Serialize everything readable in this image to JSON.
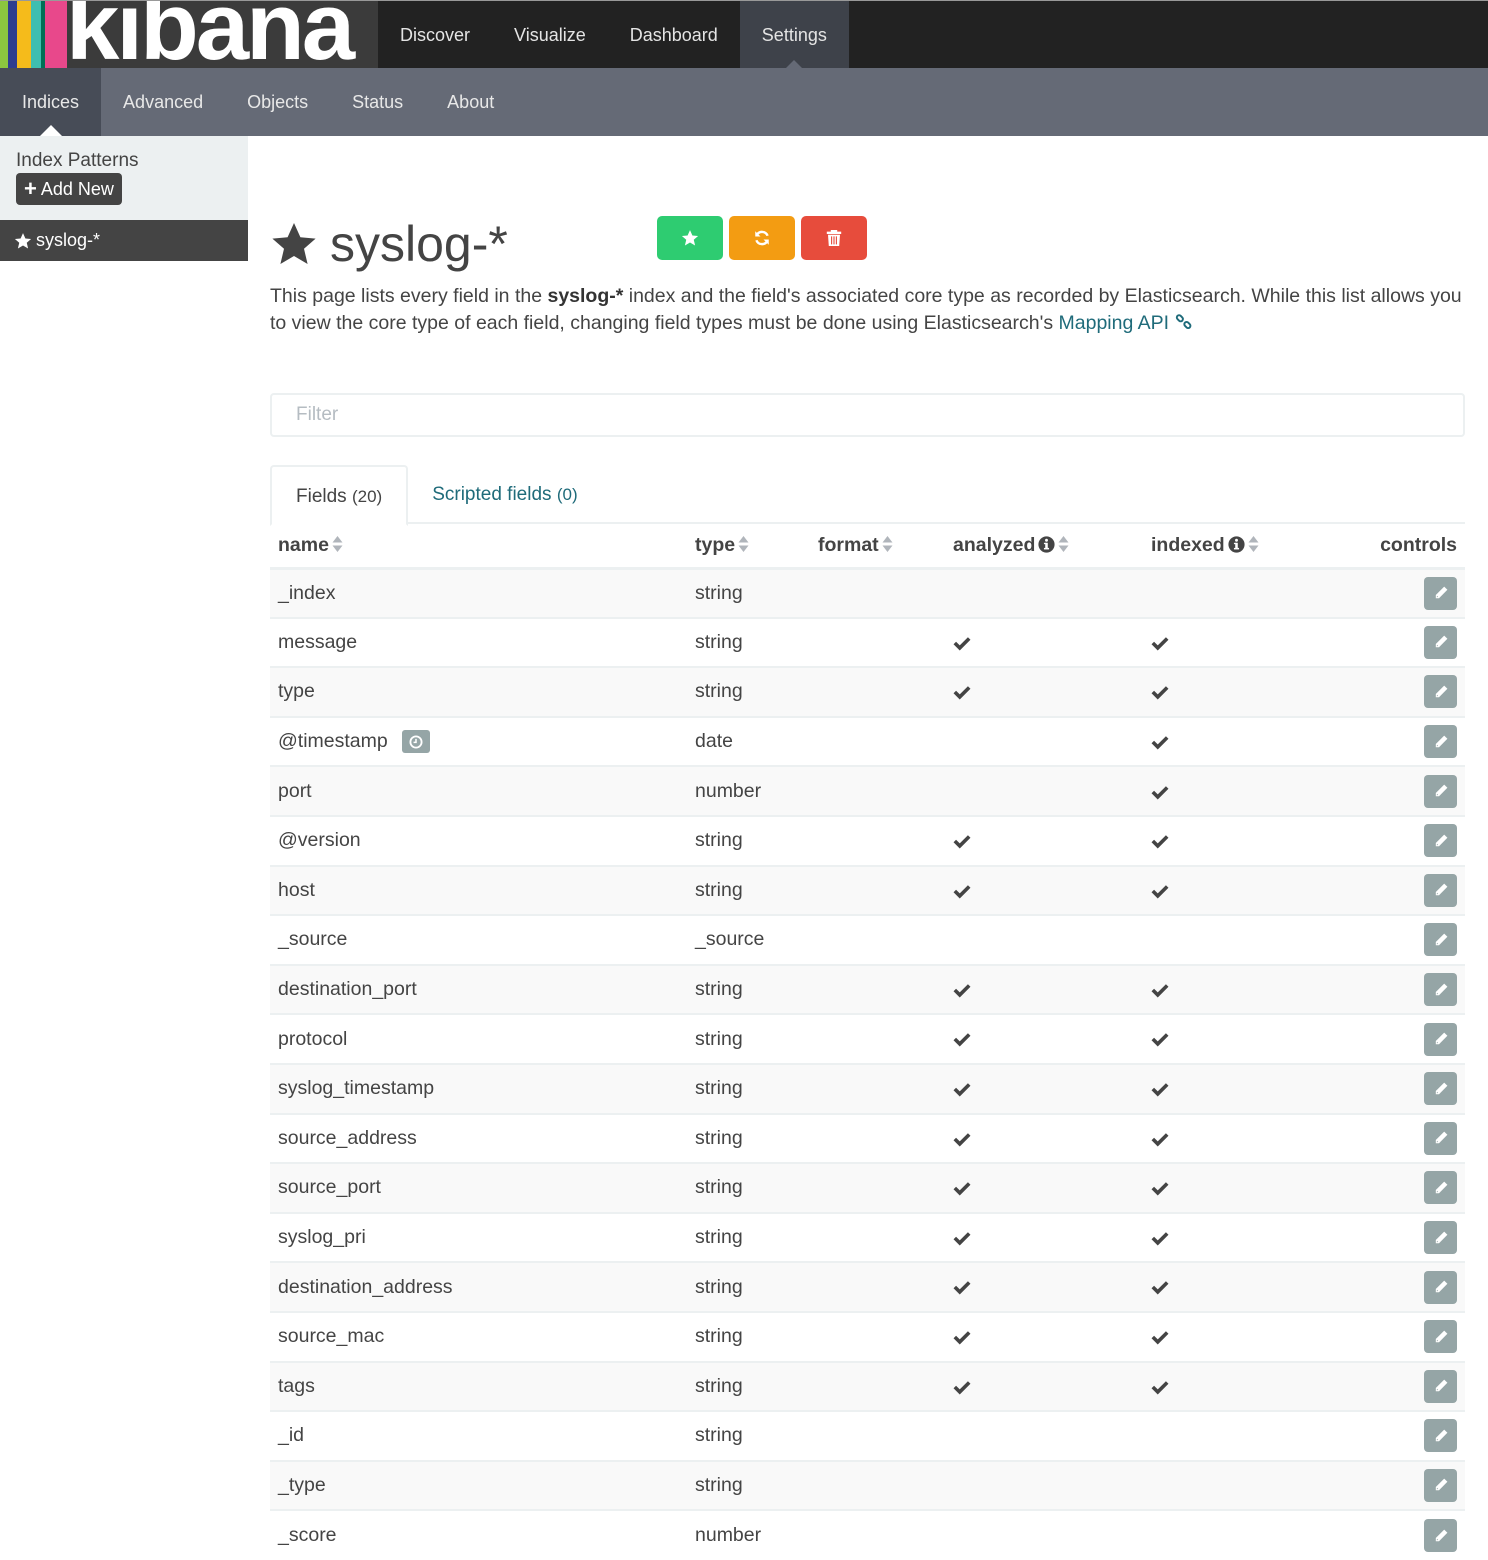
{
  "brand": {
    "name": "kibana",
    "stripe_colors": [
      "#8cc63f",
      "#2e3d8f",
      "#f5bb1b",
      "#3ebeb0",
      "#006f55",
      "#e8488b"
    ]
  },
  "topnav": {
    "items": [
      {
        "label": "Discover",
        "active": false
      },
      {
        "label": "Visualize",
        "active": false
      },
      {
        "label": "Dashboard",
        "active": false
      },
      {
        "label": "Settings",
        "active": true
      }
    ]
  },
  "subnav": {
    "items": [
      {
        "label": "Indices",
        "active": true
      },
      {
        "label": "Advanced",
        "active": false
      },
      {
        "label": "Objects",
        "active": false
      },
      {
        "label": "Status",
        "active": false
      },
      {
        "label": "About",
        "active": false
      }
    ]
  },
  "sidebar": {
    "heading": "Index Patterns",
    "add_new_label": "Add New",
    "patterns": [
      {
        "label": "syslog-*",
        "default": true
      }
    ]
  },
  "index": {
    "title": "syslog-*",
    "actions": [
      {
        "name": "set-default",
        "icon": "star-icon",
        "color": "#2ecc71"
      },
      {
        "name": "refresh-fields",
        "icon": "refresh-icon",
        "color": "#f39c12"
      },
      {
        "name": "delete-index-pattern",
        "icon": "trash-icon",
        "color": "#e74c3c"
      }
    ],
    "description": {
      "part1": "This page lists every field in the ",
      "bold": "syslog-*",
      "part2": " index and the field's associated core type as recorded by Elasticsearch. While this list allows you to view the core type of each field, changing field types must be done using Elasticsearch's ",
      "link_text": "Mapping API"
    }
  },
  "filter": {
    "placeholder": "Filter",
    "value": ""
  },
  "tabs": [
    {
      "label": "Fields",
      "count": "(20)",
      "active": true
    },
    {
      "label": "Scripted fields",
      "count": "(0)",
      "active": false
    }
  ],
  "table": {
    "columns": {
      "name": "name",
      "type": "type",
      "format": "format",
      "analyzed": "analyzed",
      "indexed": "indexed",
      "controls": "controls"
    },
    "rows": [
      {
        "name": "_index",
        "type": "string",
        "format": "",
        "analyzed": false,
        "indexed": false
      },
      {
        "name": "message",
        "type": "string",
        "format": "",
        "analyzed": true,
        "indexed": true
      },
      {
        "name": "type",
        "type": "string",
        "format": "",
        "analyzed": true,
        "indexed": true
      },
      {
        "name": "@timestamp",
        "type": "date",
        "format": "",
        "analyzed": false,
        "indexed": true,
        "time_field": true
      },
      {
        "name": "port",
        "type": "number",
        "format": "",
        "analyzed": false,
        "indexed": true
      },
      {
        "name": "@version",
        "type": "string",
        "format": "",
        "analyzed": true,
        "indexed": true
      },
      {
        "name": "host",
        "type": "string",
        "format": "",
        "analyzed": true,
        "indexed": true
      },
      {
        "name": "_source",
        "type": "_source",
        "format": "",
        "analyzed": false,
        "indexed": false
      },
      {
        "name": "destination_port",
        "type": "string",
        "format": "",
        "analyzed": true,
        "indexed": true
      },
      {
        "name": "protocol",
        "type": "string",
        "format": "",
        "analyzed": true,
        "indexed": true
      },
      {
        "name": "syslog_timestamp",
        "type": "string",
        "format": "",
        "analyzed": true,
        "indexed": true
      },
      {
        "name": "source_address",
        "type": "string",
        "format": "",
        "analyzed": true,
        "indexed": true
      },
      {
        "name": "source_port",
        "type": "string",
        "format": "",
        "analyzed": true,
        "indexed": true
      },
      {
        "name": "syslog_pri",
        "type": "string",
        "format": "",
        "analyzed": true,
        "indexed": true
      },
      {
        "name": "destination_address",
        "type": "string",
        "format": "",
        "analyzed": true,
        "indexed": true
      },
      {
        "name": "source_mac",
        "type": "string",
        "format": "",
        "analyzed": true,
        "indexed": true
      },
      {
        "name": "tags",
        "type": "string",
        "format": "",
        "analyzed": true,
        "indexed": true
      },
      {
        "name": "_id",
        "type": "string",
        "format": "",
        "analyzed": false,
        "indexed": false
      },
      {
        "name": "_type",
        "type": "string",
        "format": "",
        "analyzed": false,
        "indexed": false
      },
      {
        "name": "_score",
        "type": "number",
        "format": "",
        "analyzed": false,
        "indexed": false
      }
    ]
  }
}
